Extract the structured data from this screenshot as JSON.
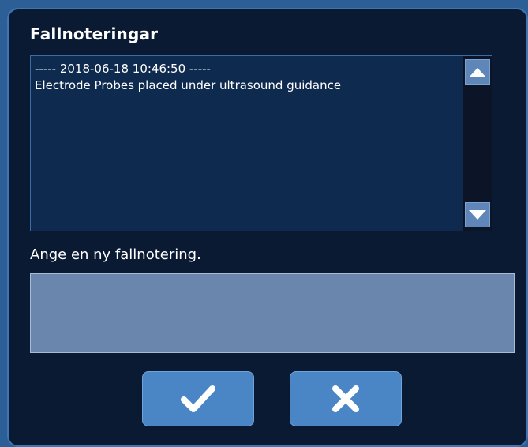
{
  "dialog": {
    "title": "Fallnoteringar",
    "notes": {
      "lines": [
        "----- 2018-06-18 10:46:50 -----",
        "Electrode Probes placed under ultrasound guidance"
      ]
    },
    "prompt_label": "Ange en ny fallnotering.",
    "new_note_value": "",
    "icons": {
      "scroll_up": "triangle-up-icon",
      "scroll_down": "triangle-down-icon",
      "confirm": "checkmark-icon",
      "cancel": "close-x-icon"
    }
  },
  "colors": {
    "dialog_background": "#0b1a33",
    "notes_background": "#0e2a4e",
    "input_background": "#6a86ac",
    "button_blue": "#4a86c6",
    "scroll_button": "#5f86b8"
  }
}
